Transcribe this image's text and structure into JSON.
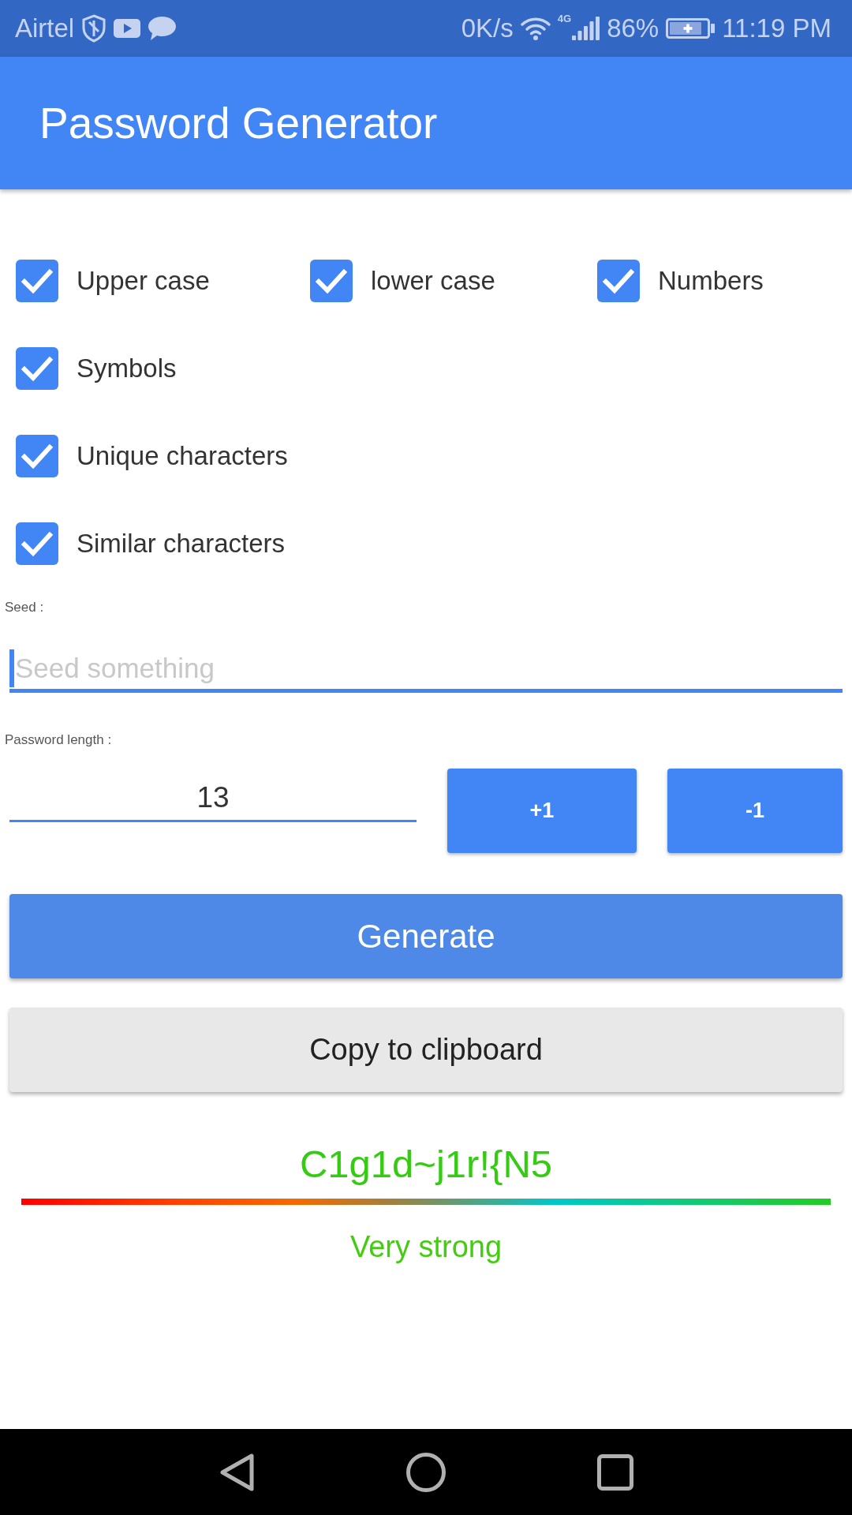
{
  "status_bar": {
    "carrier": "Airtel",
    "speed": "0K/s",
    "network": "4G",
    "battery": "86%",
    "time": "11:19 PM"
  },
  "app_bar": {
    "title": "Password Generator"
  },
  "option_rows": [
    [
      {
        "label": "Upper case",
        "checked": true
      },
      {
        "label": "lower case",
        "checked": true
      },
      {
        "label": "Numbers",
        "checked": true
      }
    ],
    [
      {
        "label": "Symbols",
        "checked": true
      }
    ],
    [
      {
        "label": "Unique characters",
        "checked": true
      }
    ],
    [
      {
        "label": "Similar characters",
        "checked": true
      }
    ]
  ],
  "seed": {
    "label": "Seed :",
    "placeholder": "Seed something",
    "focused": true
  },
  "length": {
    "label": "Password length :",
    "value": "13",
    "increment_button": "+1",
    "decrement_button": "-1"
  },
  "generate_button": "Generate",
  "copy_button": "Copy to clipboard",
  "result": {
    "password": "C1g1d~j1r!{N5",
    "strength_label": "Very strong"
  }
}
